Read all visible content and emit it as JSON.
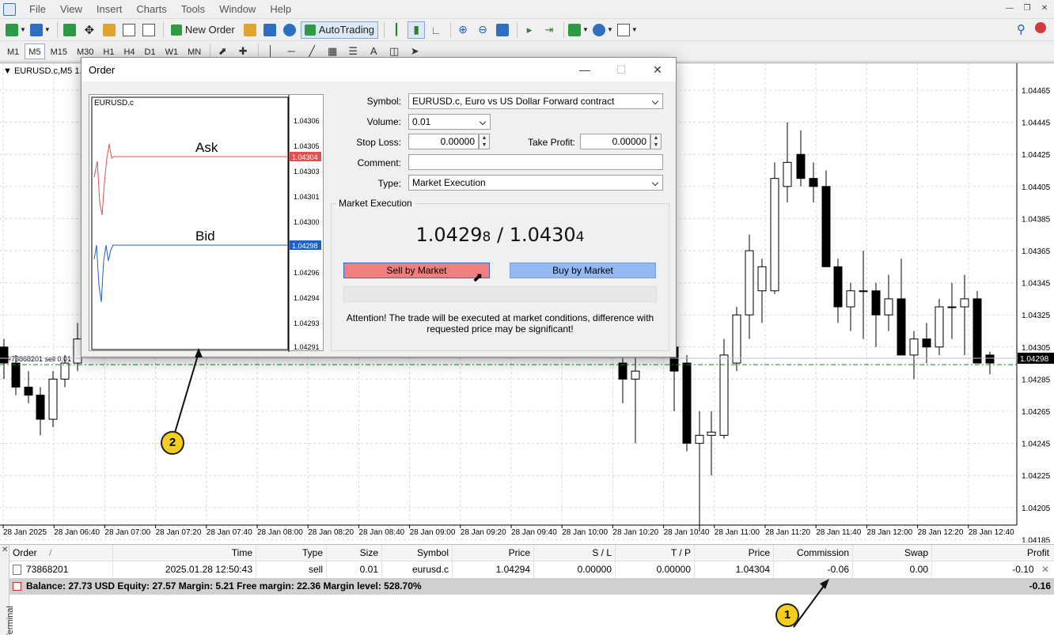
{
  "menu": {
    "items": [
      "File",
      "View",
      "Insert",
      "Charts",
      "Tools",
      "Window",
      "Help"
    ]
  },
  "toolbar": {
    "new_order_label": "New Order",
    "autotrading_label": "AutoTrading"
  },
  "timeframes": [
    "M1",
    "M5",
    "M15",
    "M30",
    "H1",
    "H4",
    "D1",
    "W1",
    "MN"
  ],
  "active_timeframe": "M5",
  "chart": {
    "label": "EURUSD.c,M5  1.04",
    "position_label": "#73868201 sell 0.01",
    "current_price": "1.04298",
    "price_ticks": [
      "1.04465",
      "1.04445",
      "1.04425",
      "1.04405",
      "1.04385",
      "1.04365",
      "1.04345",
      "1.04325",
      "1.04305",
      "1.04285",
      "1.04265",
      "1.04245",
      "1.04225",
      "1.04205",
      "1.04185"
    ],
    "time_ticks": [
      "28 Jan 2025",
      "28 Jan 06:40",
      "28 Jan 07:00",
      "28 Jan 07:20",
      "28 Jan 07:40",
      "28 Jan 08:00",
      "28 Jan 08:20",
      "28 Jan 08:40",
      "28 Jan 09:00",
      "28 Jan 09:20",
      "28 Jan 09:40",
      "28 Jan 10:00",
      "28 Jan 10:20",
      "28 Jan 10:40",
      "28 Jan 11:00",
      "28 Jan 11:20",
      "28 Jan 11:40",
      "28 Jan 12:00",
      "28 Jan 12:20",
      "28 Jan 12:40"
    ],
    "colors": {
      "bull": "#ffffff",
      "bear": "#000000",
      "level_line": "#0a8f1e"
    }
  },
  "dialog": {
    "title": "Order",
    "mini_chart": {
      "symbol": "EURUSD.c",
      "ask_label": "Ask",
      "bid_label": "Bid",
      "ticks": [
        "1.04306",
        "1.04305",
        "1.04303",
        "1.04301",
        "1.04300",
        "1.04298",
        "1.04296",
        "1.04294",
        "1.04293",
        "1.04291"
      ],
      "ask_badge": "1.04304",
      "bid_badge": "1.04298",
      "ask_color": "#e05050",
      "bid_color": "#1f5fc8"
    },
    "symbol_label": "Symbol:",
    "symbol_value": "EURUSD.c, Euro vs US Dollar Forward contract",
    "volume_label": "Volume:",
    "volume_value": "0.01",
    "stop_loss_label": "Stop Loss:",
    "stop_loss_value": "0.00000",
    "take_profit_label": "Take Profit:",
    "take_profit_value": "0.00000",
    "comment_label": "Comment:",
    "comment_value": "",
    "type_label": "Type:",
    "type_value": "Market Execution",
    "exec_group_label": "Market Execution",
    "bid_main": "1.0429",
    "bid_last": "8",
    "separator": "/",
    "ask_main": "1.0430",
    "ask_last": "4",
    "sell_label": "Sell by Market",
    "buy_label": "Buy by Market",
    "attention_text": "Attention! The trade will be executed at market conditions, difference with requested price may be significant!"
  },
  "terminal": {
    "side_label": "Terminal",
    "columns": [
      "Order",
      "Time",
      "Type",
      "Size",
      "Symbol",
      "Price",
      "S / L",
      "T / P",
      "Price",
      "Commission",
      "Swap",
      "Profit"
    ],
    "sort_marker": "/",
    "rows": [
      {
        "order": "73868201",
        "time": "2025.01.28 12:50:43",
        "type": "sell",
        "size": "0.01",
        "symbol": "eurusd.c",
        "price": "1.04294",
        "sl": "0.00000",
        "tp": "0.00000",
        "cur_price": "1.04304",
        "commission": "-0.06",
        "swap": "0.00",
        "profit": "-0.10"
      }
    ],
    "balance_text": "Balance: 27.73 USD  Equity: 27.57  Margin: 5.21  Free margin: 22.36  Margin level: 528.70%",
    "total_profit": "-0.16"
  },
  "annotations": [
    "1",
    "2"
  ]
}
